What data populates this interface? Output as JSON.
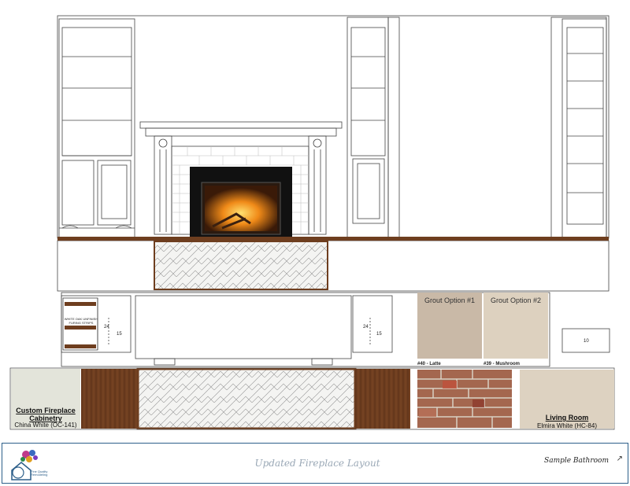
{
  "grout": {
    "option1_title": "Grout Option #1",
    "option2_title": "Grout Option #2",
    "option1_caption": "#40 - Latte",
    "option2_caption": "#39 - Mushroom",
    "option1_color": "#c9b9a7",
    "option2_color": "#ddd1bf"
  },
  "cabinetry": {
    "title": "Custom Fireplace Cabinetry",
    "color_name": "China White (OC-141)",
    "swatch_color": "#e3e4da"
  },
  "living_room": {
    "title": "Living Room",
    "color_name": "Elmira White (HC-84)",
    "swatch_color": "#ddd2c1"
  },
  "dimensions": {
    "left_height": "24",
    "left_depth": "15",
    "right_height": "24",
    "right_depth": "15",
    "bench_height": "10"
  },
  "notes": {
    "furring": "WHITE OAK UNFINISH FURING STRIPS"
  },
  "footer": {
    "title": "Updated Fireplace Layout",
    "project": "Sample Bathroom",
    "logo_text": "Fine Quality Remodeling",
    "arrow": "↗"
  },
  "colors": {
    "wood": "#6e3e1f",
    "brick_base": "#7a4a3a",
    "tile": "#f4f4f2",
    "firebox": "#111111",
    "fire": "#f0a020"
  }
}
